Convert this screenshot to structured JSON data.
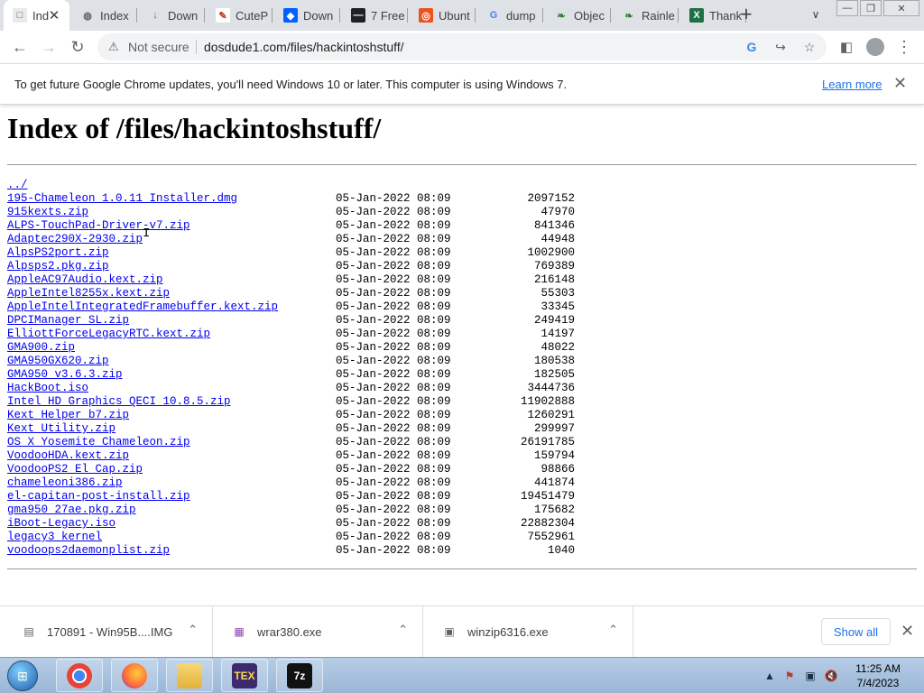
{
  "tabs": [
    {
      "title": "Ind",
      "icon": "page-icon",
      "active": true
    },
    {
      "title": "Index",
      "icon": "globe-icon"
    },
    {
      "title": "Down",
      "icon": "download-icon"
    },
    {
      "title": "CuteP",
      "icon": "cutepdf-icon"
    },
    {
      "title": "Down",
      "icon": "dropbox-icon"
    },
    {
      "title": "7 Free",
      "icon": "terminal-icon"
    },
    {
      "title": "Ubunt",
      "icon": "ubuntu-icon"
    },
    {
      "title": "dump",
      "icon": "google-icon"
    },
    {
      "title": "Objec",
      "icon": "leaf-icon"
    },
    {
      "title": "Rainle",
      "icon": "leaf-icon"
    },
    {
      "title": "Thank",
      "icon": "excel-icon"
    }
  ],
  "toolbar": {
    "security_label": "Not secure",
    "url": "dosdude1.com/files/hackintoshstuff/"
  },
  "infobar": {
    "message": "To get future Google Chrome updates, you'll need Windows 10 or later. This computer is using Windows 7.",
    "link": "Learn more"
  },
  "page": {
    "title": "Index of /files/hackintoshstuff/",
    "parent_link": "../",
    "files": [
      {
        "name": "195-Chameleon 1.0.11 Installer.dmg",
        "date": "05-Jan-2022 08:09",
        "size": "2097152"
      },
      {
        "name": "915kexts.zip",
        "date": "05-Jan-2022 08:09",
        "size": "47970"
      },
      {
        "name": "ALPS-TouchPad-Driver-v7.zip",
        "date": "05-Jan-2022 08:09",
        "size": "841346"
      },
      {
        "name": "Adaptec290X-2930.zip",
        "date": "05-Jan-2022 08:09",
        "size": "44948"
      },
      {
        "name": "AlpsPS2port.zip",
        "date": "05-Jan-2022 08:09",
        "size": "1002900"
      },
      {
        "name": "Alpsps2.pkg.zip",
        "date": "05-Jan-2022 08:09",
        "size": "769389"
      },
      {
        "name": "AppleAC97Audio.kext.zip",
        "date": "05-Jan-2022 08:09",
        "size": "216148"
      },
      {
        "name": "AppleIntel8255x.kext.zip",
        "date": "05-Jan-2022 08:09",
        "size": "55303"
      },
      {
        "name": "AppleIntelIntegratedFramebuffer.kext.zip",
        "date": "05-Jan-2022 08:09",
        "size": "33345"
      },
      {
        "name": "DPCIManager_SL.zip",
        "date": "05-Jan-2022 08:09",
        "size": "249419"
      },
      {
        "name": "ElliottForceLegacyRTC.kext.zip",
        "date": "05-Jan-2022 08:09",
        "size": "14197"
      },
      {
        "name": "GMA900.zip",
        "date": "05-Jan-2022 08:09",
        "size": "48022"
      },
      {
        "name": "GMA950GX620.zip",
        "date": "05-Jan-2022 08:09",
        "size": "180538"
      },
      {
        "name": "GMA950_v3.6.3.zip",
        "date": "05-Jan-2022 08:09",
        "size": "182505"
      },
      {
        "name": "HackBoot.iso",
        "date": "05-Jan-2022 08:09",
        "size": "3444736"
      },
      {
        "name": "Intel HD Graphics QECI 10.8.5.zip",
        "date": "05-Jan-2022 08:09",
        "size": "11902888"
      },
      {
        "name": "Kext Helper b7.zip",
        "date": "05-Jan-2022 08:09",
        "size": "1260291"
      },
      {
        "name": "Kext Utility.zip",
        "date": "05-Jan-2022 08:09",
        "size": "299997"
      },
      {
        "name": "OS X Yosemite Chameleon.zip",
        "date": "05-Jan-2022 08:09",
        "size": "26191785"
      },
      {
        "name": "VoodooHDA.kext.zip",
        "date": "05-Jan-2022 08:09",
        "size": "159794"
      },
      {
        "name": "VoodooPS2 El Cap.zip",
        "date": "05-Jan-2022 08:09",
        "size": "98866"
      },
      {
        "name": "chameleoni386.zip",
        "date": "05-Jan-2022 08:09",
        "size": "441874"
      },
      {
        "name": "el-capitan-post-install.zip",
        "date": "05-Jan-2022 08:09",
        "size": "19451479"
      },
      {
        "name": "gma950_27ae.pkg.zip",
        "date": "05-Jan-2022 08:09",
        "size": "175682"
      },
      {
        "name": "iBoot-Legacy.iso",
        "date": "05-Jan-2022 08:09",
        "size": "22882304"
      },
      {
        "name": "legacy3_kernel",
        "date": "05-Jan-2022 08:09",
        "size": "7552961"
      },
      {
        "name": "voodoops2daemonplist.zip",
        "date": "05-Jan-2022 08:09",
        "size": "1040"
      }
    ]
  },
  "downloads": {
    "items": [
      {
        "name": "170891 - Win95B....IMG",
        "icon": "disk-image-icon"
      },
      {
        "name": "wrar380.exe",
        "icon": "winrar-icon"
      },
      {
        "name": "winzip6316.exe",
        "icon": "installer-icon"
      }
    ],
    "show_all": "Show all"
  },
  "taskbar": {
    "apps": [
      {
        "name": "chrome-icon",
        "label": ""
      },
      {
        "name": "firefox-icon",
        "label": ""
      },
      {
        "name": "folder-icon",
        "label": ""
      },
      {
        "name": "tex-icon",
        "label": "TEX"
      },
      {
        "name": "7zip-icon",
        "label": "7z"
      }
    ],
    "time": "11:25 AM",
    "date": "7/4/2023"
  },
  "colors": {
    "link": "#0000ee",
    "tabstrip": "#dee1e6",
    "accent": "#1a73e8",
    "taskbar": "#a9c2df"
  }
}
